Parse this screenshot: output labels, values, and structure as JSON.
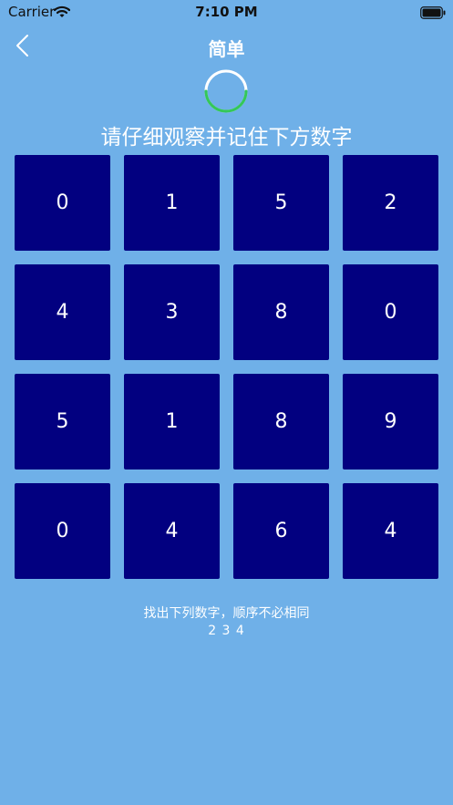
{
  "status_bar": {
    "carrier": "Carrier",
    "time": "7:10 PM"
  },
  "nav": {
    "title": "简单",
    "back_icon": "chevron-left-icon"
  },
  "timer": {
    "progress": 0.5,
    "track_color": "#ffffff",
    "progress_color": "#34c759"
  },
  "instruction": "请仔细观察并记住下方数字",
  "grid": {
    "cells": [
      "0",
      "1",
      "5",
      "2",
      "4",
      "3",
      "8",
      "0",
      "5",
      "1",
      "8",
      "9",
      "0",
      "4",
      "6",
      "4"
    ],
    "cell_color": "#020080"
  },
  "prompt": "找出下列数字，顺序不必相同",
  "targets": "2 3 4",
  "colors": {
    "background": "#6fb0e8",
    "text": "#ffffff"
  }
}
